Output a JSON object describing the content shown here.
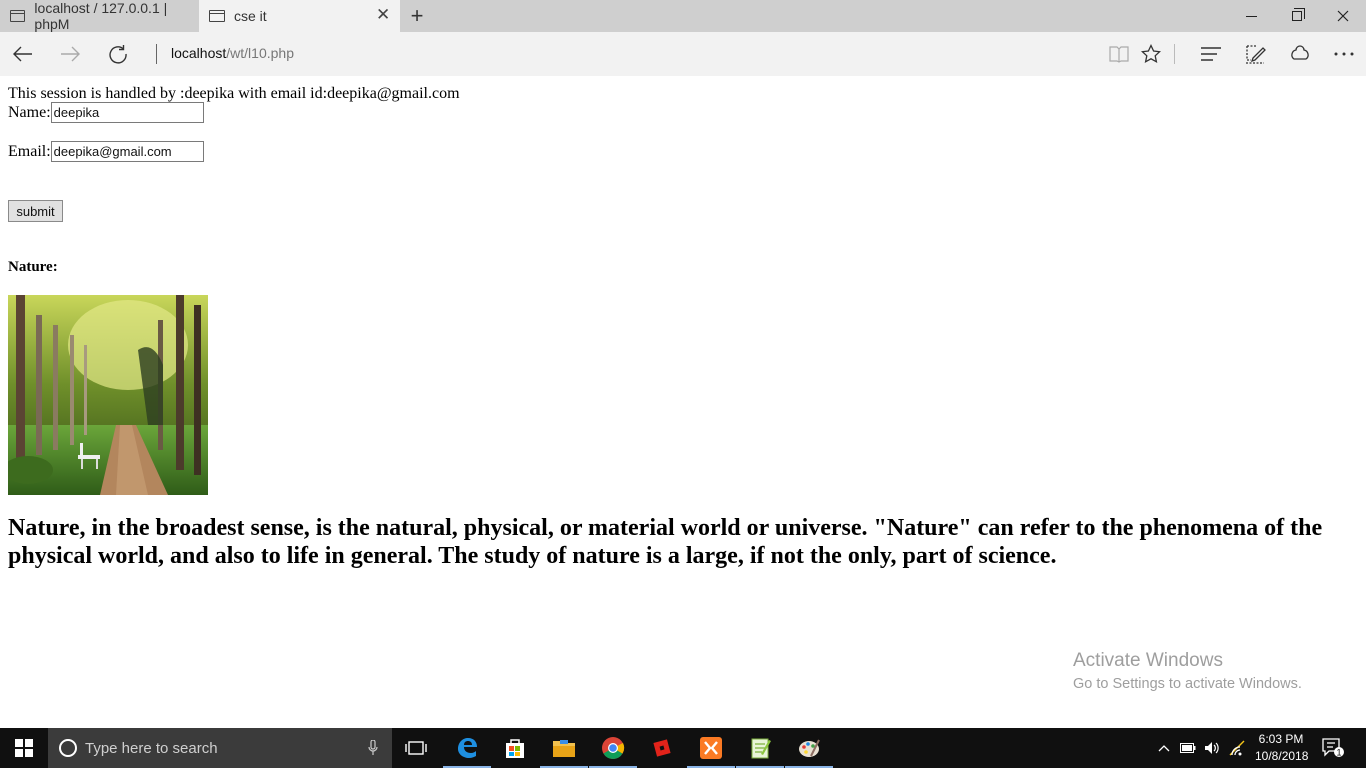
{
  "browser": {
    "tabs": [
      {
        "title": "localhost / 127.0.0.1 | phpM",
        "active": false
      },
      {
        "title": "cse it",
        "active": true
      }
    ],
    "address": {
      "host": "localhost",
      "path": "/wt/l10.php"
    }
  },
  "page": {
    "session_msg": "This session is handled by :deepika with email id:deepika@gmail.com",
    "name_label": "Name:",
    "name_value": "deepika",
    "email_label": "Email:",
    "email_value": "deepika@gmail.com",
    "submit_label": "submit",
    "nature_heading": "Nature:",
    "nature_text": "Nature, in the broadest sense, is the natural, physical, or material world or universe. \"Nature\" can refer to the phenomena of the physical world, and also to life in general. The study of nature is a large, if not the only, part of science."
  },
  "watermark": {
    "title": "Activate Windows",
    "subtitle": "Go to Settings to activate Windows."
  },
  "taskbar": {
    "search_placeholder": "Type here to search",
    "apps": [
      "task-view",
      "edge",
      "store",
      "file-explorer",
      "chrome",
      "roblox",
      "xampp",
      "notepad",
      "paint"
    ],
    "time": "6:03 PM",
    "date": "10/8/2018",
    "notifications": "1"
  },
  "colors": {
    "accent": "#0078d7",
    "taskbar": "#101010",
    "tabstrip": "#cfcfcf"
  }
}
